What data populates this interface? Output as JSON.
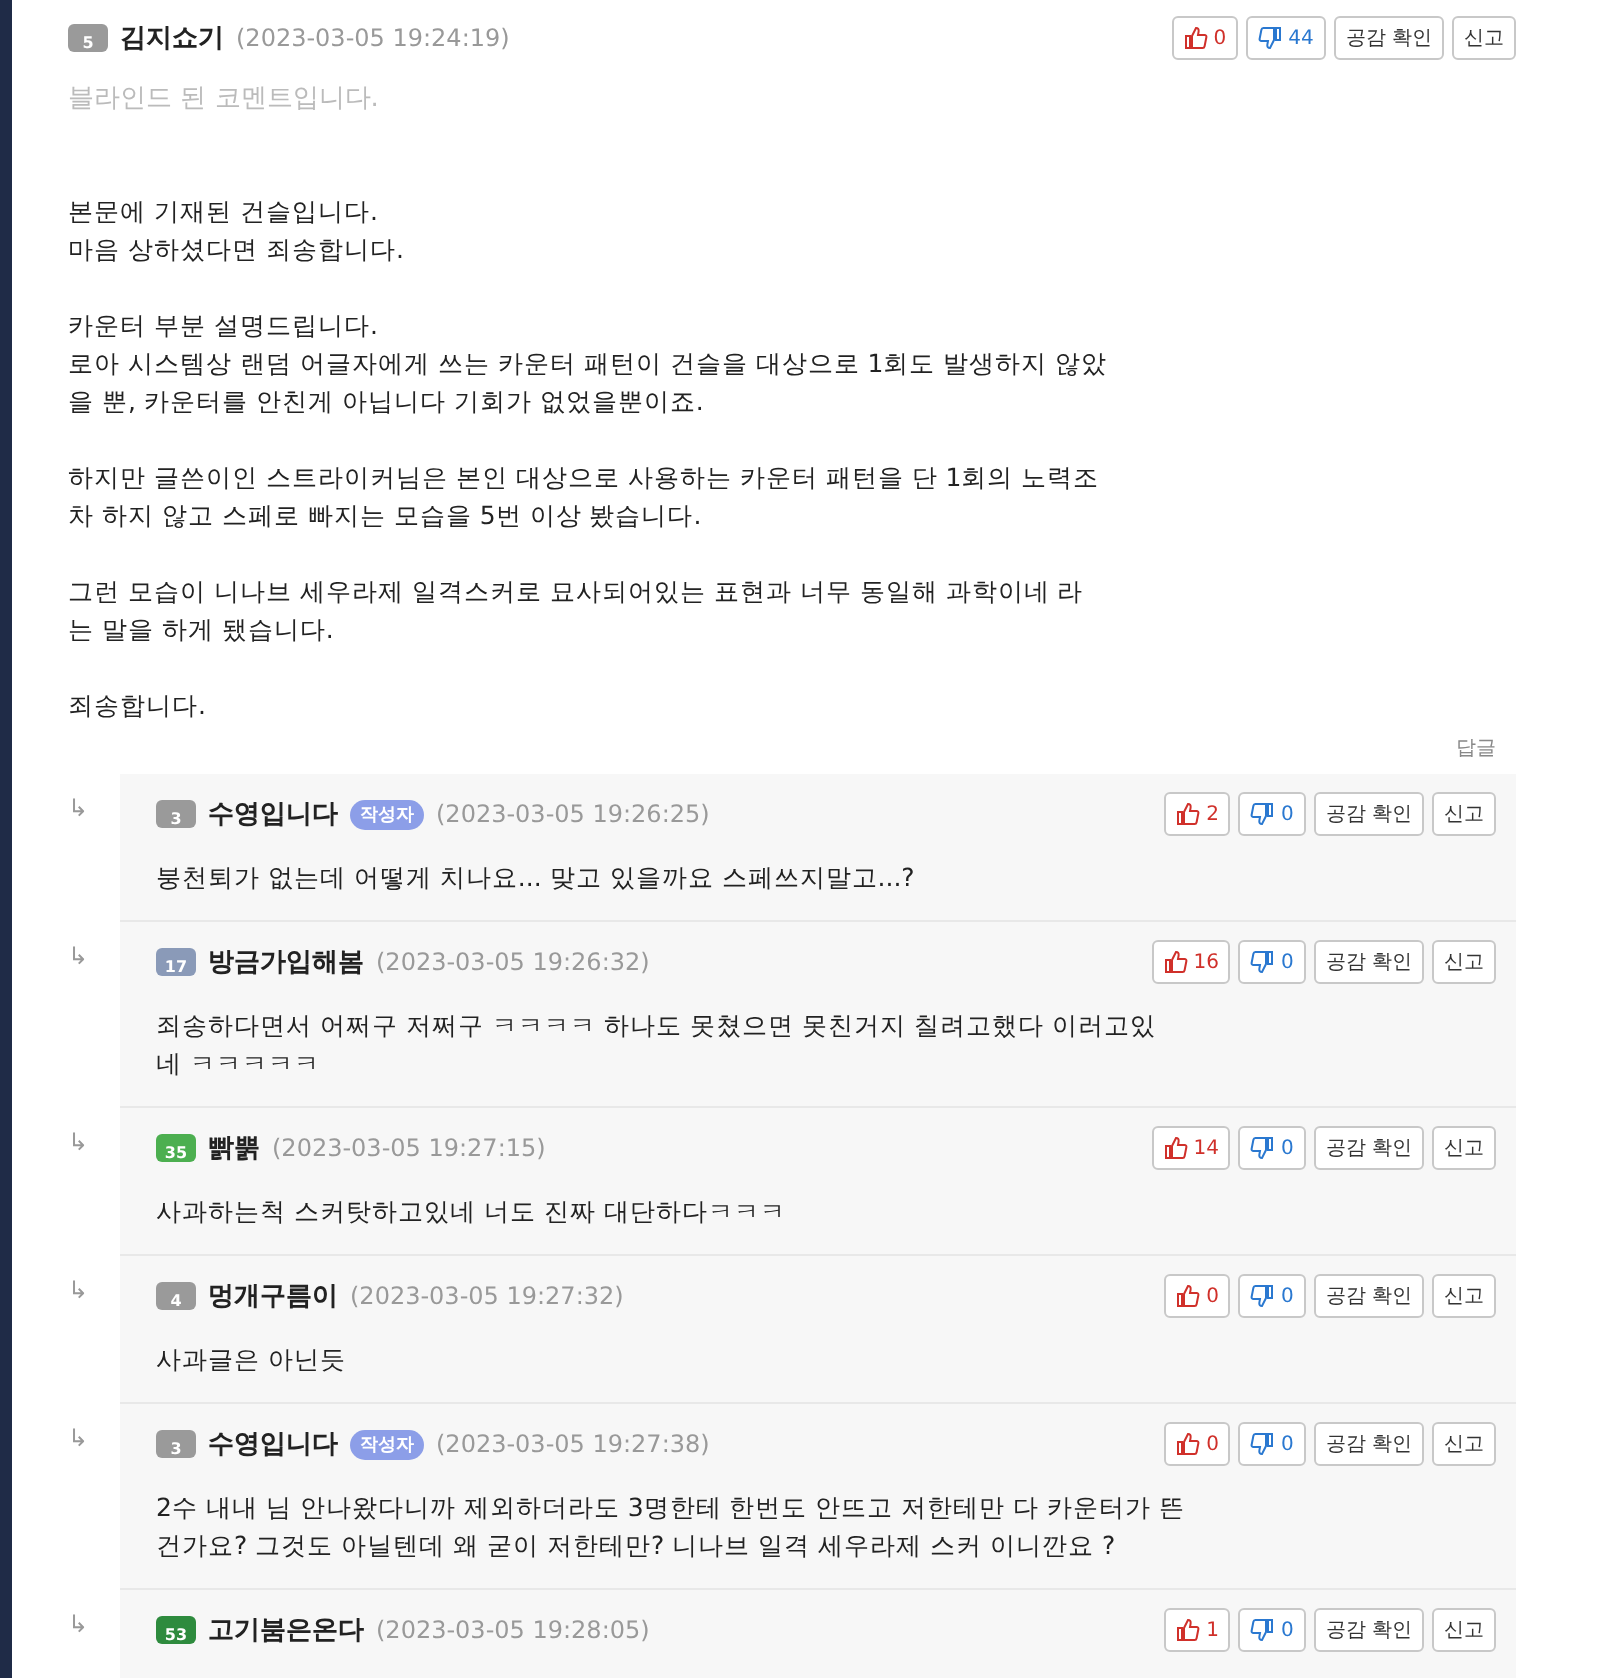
{
  "comment": {
    "level_badge": "5",
    "color": "#9a9a9a",
    "author": "김지쇼기",
    "date": "(2023-03-05 19:24:19)",
    "likes": "0",
    "dislikes": "44",
    "check_label": "공감 확인",
    "report_label": "신고",
    "blinded_notice": "블라인드 된 코멘트입니다.",
    "paragraphs": [
      [
        "본문에 기재된 건슬입니다.",
        "마음 상하셨다면 죄송합니다."
      ],
      [
        "카운터 부분 설명드립니다.",
        "로아 시스템상 랜덤 어글자에게 쓰는 카운터 패턴이 건슬을 대상으로 1회도 발생하지 않았",
        "을 뿐, 카운터를 안친게 아닙니다 기회가 없었을뿐이죠."
      ],
      [
        "하지만 글쓴이인 스트라이커님은 본인 대상으로 사용하는 카운터 패턴을 단 1회의 노력조",
        "차 하지 않고 스페로 빠지는 모습을 5번 이상 봤습니다."
      ],
      [
        "그런 모습이 니나브 세우라제 일격스커로 묘사되어있는 표현과 너무 동일해 과학이네 라",
        "는 말을 하게 됐습니다."
      ],
      [
        "죄송합니다."
      ]
    ],
    "reply_link": "답글"
  },
  "replies": [
    {
      "arrow": "↳",
      "level_badge": "3",
      "color": "#9a9a9a",
      "author": "수영입니다",
      "is_writer": true,
      "writer_label": "작성자",
      "date": "(2023-03-05 19:26:25)",
      "likes": "2",
      "dislikes": "0",
      "check_label": "공감 확인",
      "report_label": "신고",
      "lines": [
        "붕천퇴가 없는데 어떻게 치나요... 맞고 있을까요 스페쓰지말고...?"
      ]
    },
    {
      "arrow": "↳",
      "level_badge": "17",
      "color": "#8a9ab8",
      "author": "방금가입해봄",
      "is_writer": false,
      "date": "(2023-03-05 19:26:32)",
      "likes": "16",
      "dislikes": "0",
      "check_label": "공감 확인",
      "report_label": "신고",
      "lines": [
        "죄송하다면서 어쩌구 저쩌구 ㅋㅋㅋㅋ 하나도 못쳤으면 못친거지 칠려고했다 이러고있",
        "네 ㅋㅋㅋㅋㅋ"
      ]
    },
    {
      "arrow": "↳",
      "level_badge": "35",
      "color": "#4caf50",
      "author": "빩뿕",
      "is_writer": false,
      "date": "(2023-03-05 19:27:15)",
      "likes": "14",
      "dislikes": "0",
      "check_label": "공감 확인",
      "report_label": "신고",
      "lines": [
        "사과하는척 스커탓하고있네 너도 진짜 대단하다ㅋㅋㅋ"
      ]
    },
    {
      "arrow": "↳",
      "level_badge": "4",
      "color": "#9a9a9a",
      "author": "멍개구름이",
      "is_writer": false,
      "date": "(2023-03-05 19:27:32)",
      "likes": "0",
      "dislikes": "0",
      "check_label": "공감 확인",
      "report_label": "신고",
      "lines": [
        "사과글은 아닌듯"
      ]
    },
    {
      "arrow": "↳",
      "level_badge": "3",
      "color": "#9a9a9a",
      "author": "수영입니다",
      "is_writer": true,
      "writer_label": "작성자",
      "date": "(2023-03-05 19:27:38)",
      "likes": "0",
      "dislikes": "0",
      "check_label": "공감 확인",
      "report_label": "신고",
      "lines": [
        "2수 내내 님 안나왔다니까 제외하더라도 3명한테 한번도 안뜨고 저한테만 다 카운터가 뜬",
        "건가요? 그것도 아닐텐데 왜 굳이 저한테만? 니나브 일격 세우라제 스커 이니깐요 ?"
      ]
    },
    {
      "arrow": "↳",
      "level_badge": "53",
      "color": "#2e8b3e",
      "author": "고기붐은온다",
      "is_writer": false,
      "date": "(2023-03-05 19:28:05)",
      "likes": "1",
      "dislikes": "0",
      "check_label": "공감 확인",
      "report_label": "신고"
    }
  ]
}
